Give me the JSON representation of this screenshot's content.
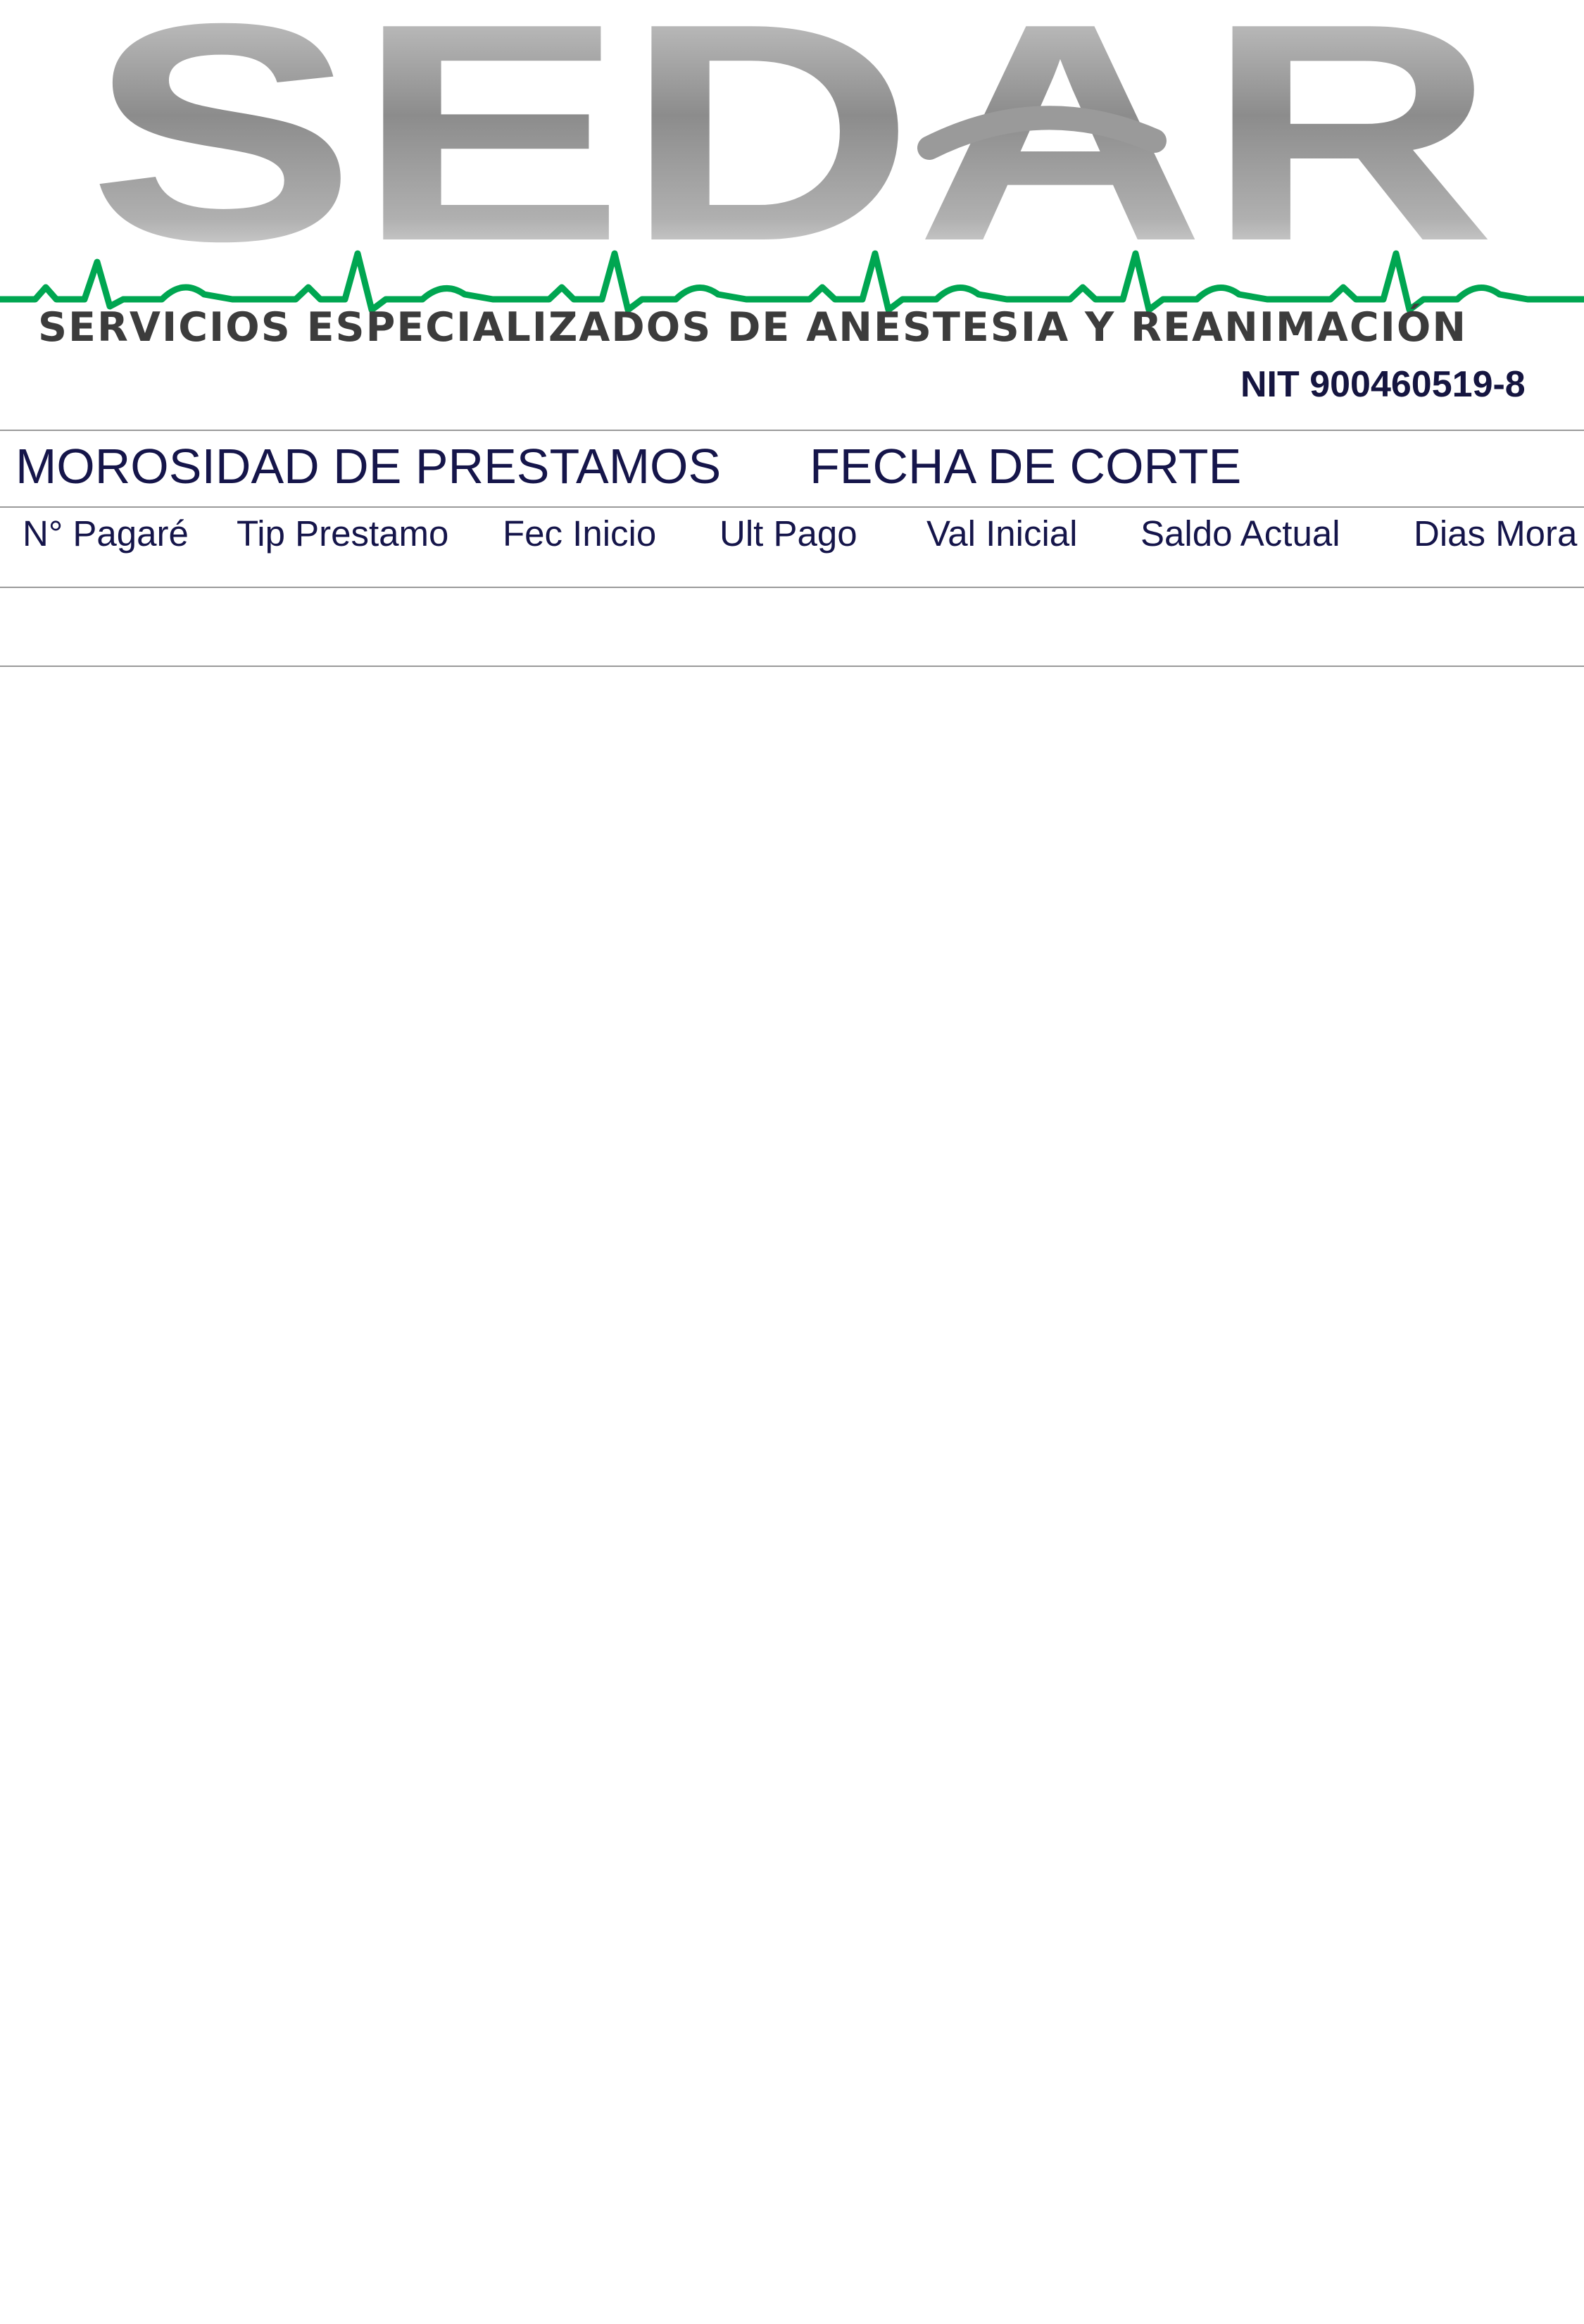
{
  "header": {
    "logo_text": "SEDAR",
    "tagline": "SERVICIOS ESPECIALIZADOS DE ANESTESIA Y REANIMACIÓN",
    "nit": "NIT 900460519-8",
    "colors": {
      "logo_gray": "#8e8e8e",
      "ekg_green": "#00a651",
      "tagline_gray": "#3c3c3c",
      "text_navy": "#15154a"
    }
  },
  "report": {
    "title": "MOROSIDAD DE PRESTAMOS",
    "cutoff_label": "FECHA DE CORTE",
    "cutoff_value": ""
  },
  "table": {
    "columns": [
      "N° Pagaré",
      "Tip Prestamo",
      "Fec Inicio",
      "Ult Pago",
      "Val Inicial",
      "Saldo Actual",
      "Dias Mora"
    ],
    "rows": []
  }
}
